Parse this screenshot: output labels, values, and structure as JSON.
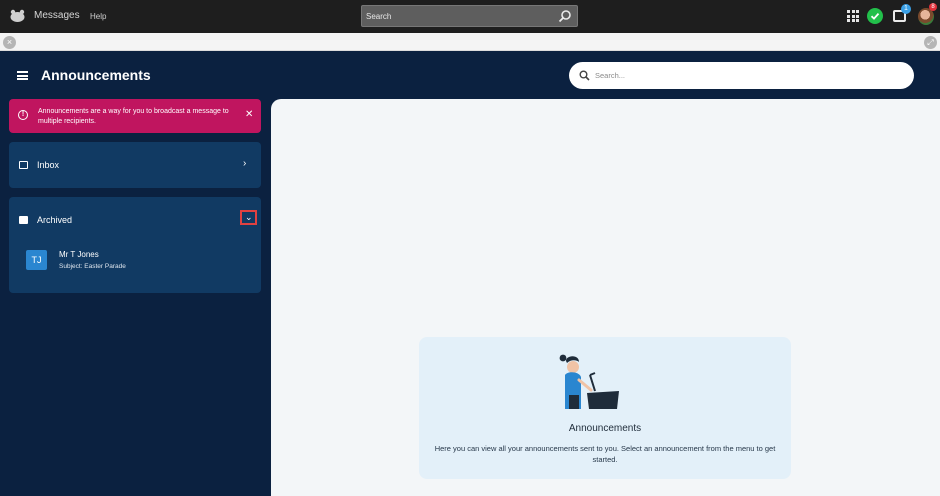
{
  "topbar": {
    "app_name": "Messages",
    "help_label": "Help",
    "search_placeholder": "Search",
    "inbox_badge": "1",
    "avatar_badge": "8"
  },
  "header": {
    "title": "Announcements",
    "search_placeholder": "Search..."
  },
  "sidebar": {
    "alert_text": "Announcements are a way for you to broadcast a message to multiple recipients.",
    "inbox_label": "Inbox",
    "archived_label": "Archived",
    "archived_items": [
      {
        "initials": "TJ",
        "name": "Mr T Jones",
        "subject": "Subject: Easter Parade"
      }
    ]
  },
  "main": {
    "empty_title": "Announcements",
    "empty_description": "Here you can view all your announcements sent to you. Select an announcement from the menu to get started."
  },
  "colors": {
    "navy": "#0b2140",
    "panel": "#113a63",
    "alert": "#c0155f",
    "accent_blue": "#2a86d0",
    "success": "#22c04b"
  }
}
